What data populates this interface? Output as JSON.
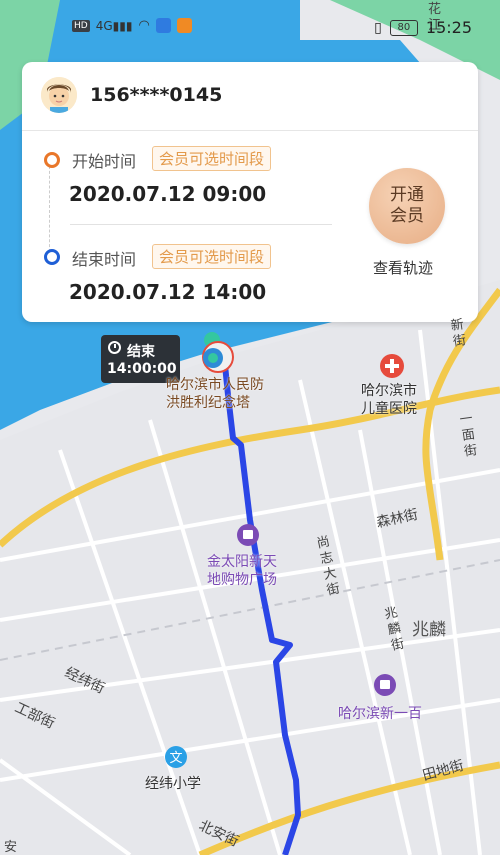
{
  "status_bar": {
    "left_icons": [
      "HD",
      "4G",
      "signal-icon",
      "wifi-icon",
      "app-icon-1",
      "app-icon-2"
    ],
    "battery": "80",
    "time": "15:25"
  },
  "card": {
    "phone": "156****0145",
    "start": {
      "label": "开始时间",
      "tag": "会员可选时间段",
      "time": "2020.07.12 09:00"
    },
    "end": {
      "label": "结束时间",
      "tag": "会员可选时间段",
      "time": "2020.07.12 14:00"
    },
    "vip_button": {
      "line1": "开通",
      "line2": "会员"
    },
    "track_link": "查看轨迹"
  },
  "end_marker": {
    "label": "结束",
    "time": "14:00:00"
  },
  "map_labels": {
    "poi_monument": "哈尔滨市人民防\n洪胜利纪念塔",
    "poi_hospital": "哈尔滨市\n儿童医院",
    "poi_mall": "金太阳新天\n地购物广场",
    "poi_store": "哈尔滨新一百",
    "poi_school": "经纬小学",
    "area_zhaolin": "兆麟",
    "street_senlin": "森林街",
    "street_shangzhi": "尚\n志\n大\n街",
    "street_zhaolinjie": "兆\n麟\n街",
    "street_jingwei": "经纬街",
    "street_gongbu": "工部街",
    "street_beian": "北安街",
    "street_tiandi": "田地街",
    "street_yimian": "一\n面\n街",
    "street_xin": "新\n街",
    "street_top": "花\n江",
    "street_corner": "安"
  },
  "colors": {
    "orange": "#e9772a",
    "blue": "#1f5fd6",
    "route": "#2b46e6",
    "water": "#3aa7e6",
    "poi_purple": "#7b4bb5",
    "poi_red": "#e64b3c"
  }
}
